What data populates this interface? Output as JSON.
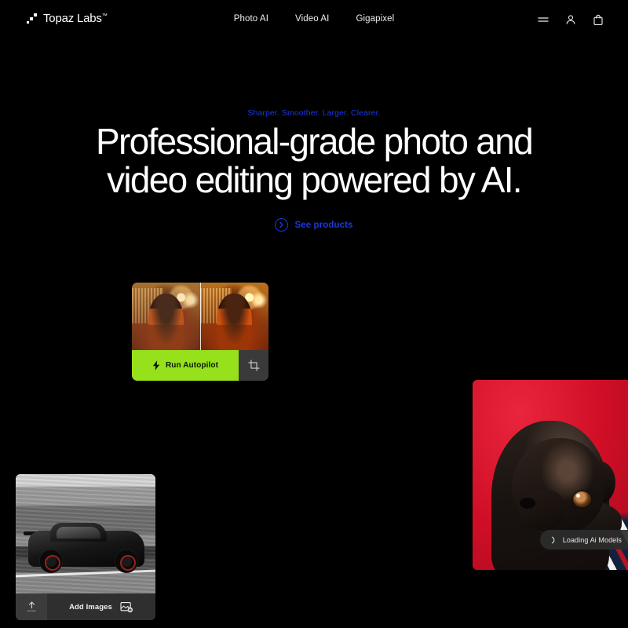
{
  "site": {
    "background_color": "#000000",
    "accent_blue": "#1b37e0",
    "accent_green": "#96e11b",
    "accent_red": "#d9112a"
  },
  "nav": {
    "logo": {
      "text": "Topaz Labs",
      "trademark": "™",
      "icon": "topaz-diagonal-squares-icon"
    },
    "links": [
      {
        "label": "Photo AI",
        "name": "nav-link-photo-ai"
      },
      {
        "label": "Video AI",
        "name": "nav-link-video-ai"
      },
      {
        "label": "Gigapixel",
        "name": "nav-link-gigapixel"
      }
    ],
    "actions": [
      {
        "name": "hamburger-menu-icon",
        "label": "Menu"
      },
      {
        "name": "user-account-icon",
        "label": "Account"
      },
      {
        "name": "shopping-bag-icon",
        "label": "Cart"
      }
    ]
  },
  "hero": {
    "eyebrow": "Sharper. Smoother. Larger. Clearer.",
    "headline_line1": "Professional-grade photo and",
    "headline_line2": "video editing powered by AI.",
    "cta": {
      "label": "See products",
      "icon": "chevron-right-circle-icon"
    }
  },
  "cards": {
    "autopilot": {
      "name": "autopilot-card",
      "image_alt": "before-after-portrait-comparison",
      "run_button": {
        "label": "Run Autopilot",
        "icon": "lightning-bolt-icon",
        "background": "#96e11b"
      },
      "crop_button": {
        "icon": "crop-tool-icon",
        "label": "Crop"
      }
    },
    "pug": {
      "name": "pug-portrait-card",
      "image_alt": "black-pug-on-red-background",
      "badge": {
        "label": "Loading Ai Models",
        "icon": "loading-spinner-icon"
      }
    },
    "car": {
      "name": "car-photo-card",
      "image_alt": "black-sports-car-motion-blur",
      "upload_button": {
        "icon": "upload-arrow-icon",
        "label": "Upload"
      },
      "add_button": {
        "label": "Add Images",
        "icon": "add-image-icon"
      }
    }
  }
}
